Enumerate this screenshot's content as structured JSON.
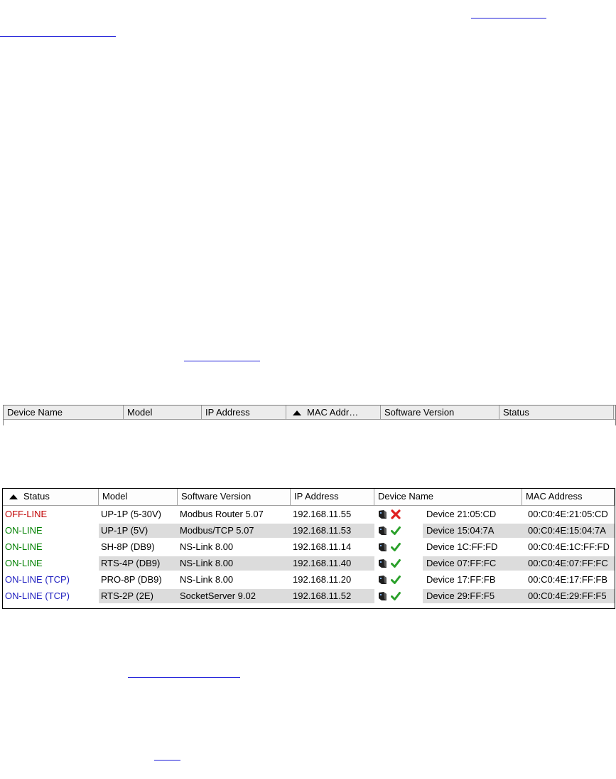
{
  "grid_empty": {
    "columns": [
      {
        "label": "Device Name"
      },
      {
        "label": "Model"
      },
      {
        "label": "IP Address"
      },
      {
        "label": "MAC Addr…",
        "sorted": "ascending"
      },
      {
        "label": "Software Version"
      },
      {
        "label": "Status"
      }
    ]
  },
  "grid_devices": {
    "columns": [
      {
        "label": "Status",
        "sorted": "ascending"
      },
      {
        "label": "Model"
      },
      {
        "label": "Software Version"
      },
      {
        "label": "IP Address"
      },
      {
        "label": "Device Name"
      },
      {
        "label": "MAC Address"
      }
    ],
    "rows": [
      {
        "status": "OFF-LINE",
        "status_color": "#c00000",
        "model": "UP-1P (5-30V)",
        "software": "Modbus Router 5.07",
        "ip": "192.168.11.55",
        "state_icon": "red-x-icon",
        "device_name": "Device 21:05:CD",
        "mac": "00:C0:4E:21:05:CD"
      },
      {
        "status": "ON-LINE",
        "status_color": "#008000",
        "model": "UP-1P (5V)",
        "software": "Modbus/TCP 5.07",
        "ip": "192.168.11.53",
        "state_icon": "green-check-icon",
        "device_name": "Device 15:04:7A",
        "mac": "00:C0:4E:15:04:7A"
      },
      {
        "status": "ON-LINE",
        "status_color": "#008000",
        "model": "SH-8P (DB9)",
        "software": "NS-Link 8.00",
        "ip": "192.168.11.14",
        "state_icon": "green-check-icon",
        "device_name": "Device 1C:FF:FD",
        "mac": "00:C0:4E:1C:FF:FD"
      },
      {
        "status": "ON-LINE",
        "status_color": "#008000",
        "model": "RTS-4P (DB9)",
        "software": "NS-Link 8.00",
        "ip": "192.168.11.40",
        "state_icon": "green-check-icon",
        "device_name": "Device 07:FF:FC",
        "mac": "00:C0:4E:07:FF:FC"
      },
      {
        "status": "ON-LINE (TCP)",
        "status_color": "#2020c0",
        "model": "PRO-8P (DB9)",
        "software": "NS-Link 8.00",
        "ip": "192.168.11.20",
        "state_icon": "green-check-icon",
        "device_name": "Device 17:FF:FB",
        "mac": "00:C0:4E:17:FF:FB"
      },
      {
        "status": "ON-LINE (TCP)",
        "status_color": "#2020c0",
        "model": "RTS-2P (2E)",
        "software": "SocketServer 9.02",
        "ip": "192.168.11.52",
        "state_icon": "green-check-icon",
        "device_name": "Device 29:FF:F5",
        "mac": "00:C0:4E:29:FF:F5"
      }
    ]
  }
}
